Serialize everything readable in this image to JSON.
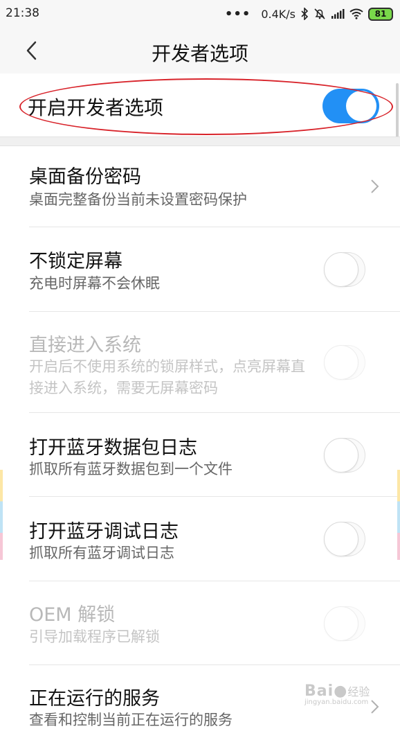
{
  "status_bar": {
    "time": "21:38",
    "dots": "•••",
    "network_speed": "0.4K/s",
    "battery": "81"
  },
  "header": {
    "title": "开发者选项"
  },
  "master": {
    "label": "开启开发者选项",
    "on": true
  },
  "rows": [
    {
      "title": "桌面备份密码",
      "subtitle": "桌面完整备份当前未设置密码保护",
      "control": "chevron",
      "disabled": false
    },
    {
      "title": "不锁定屏幕",
      "subtitle": "充电时屏幕不会休眠",
      "control": "switch",
      "on": false,
      "disabled": false
    },
    {
      "title": "直接进入系统",
      "subtitle": "开启后不使用系统的锁屏样式，点亮屏幕直接进入系统，需要无屏幕密码",
      "control": "switch",
      "on": false,
      "disabled": true
    },
    {
      "title": "打开蓝牙数据包日志",
      "subtitle": "抓取所有蓝牙数据包到一个文件",
      "control": "switch",
      "on": false,
      "disabled": false
    },
    {
      "title": "打开蓝牙调试日志",
      "subtitle": "抓取所有蓝牙调试日志",
      "control": "switch",
      "on": false,
      "disabled": false
    },
    {
      "title": "OEM 解锁",
      "subtitle": "引导加载程序已解锁",
      "control": "switch",
      "on": false,
      "disabled": true
    },
    {
      "title": "正在运行的服务",
      "subtitle": "查看和控制当前正在运行的服务",
      "control": "chevron",
      "disabled": false
    }
  ],
  "watermark": {
    "brand": "Bai",
    "suffix": "经验",
    "url": "jingyan.baidu.com"
  },
  "colors": {
    "accent": "#2290f5",
    "annotation": "#d8232a"
  }
}
